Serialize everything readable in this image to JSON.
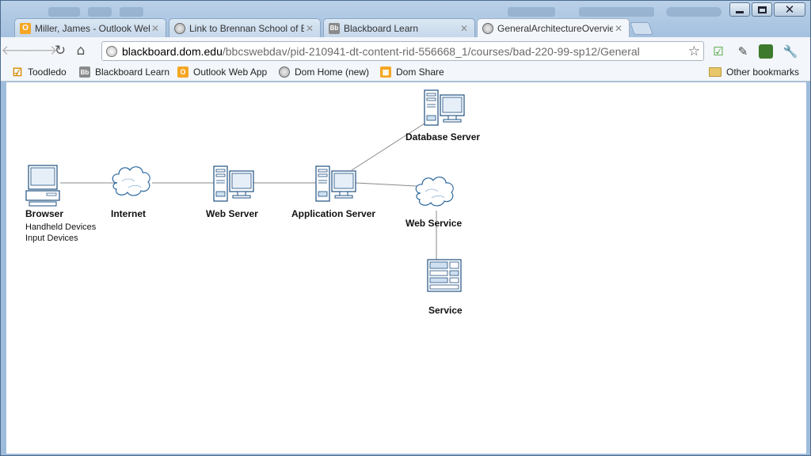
{
  "tabs": [
    {
      "title": "Miller, James - Outlook Web",
      "icon": "outlook-icon",
      "active": false
    },
    {
      "title": "Link to Brennan School of B",
      "icon": "globe-icon",
      "active": false
    },
    {
      "title": "Blackboard Learn",
      "icon": "blackboard-icon",
      "active": false
    },
    {
      "title": "GeneralArchitectureOvervie",
      "icon": "globe-icon",
      "active": true
    }
  ],
  "omnibox": {
    "host": "blackboard.dom.edu",
    "path": "/bbcswebdav/pid-210941-dt-content-rid-556668_1/courses/bad-220-99-sp12/General"
  },
  "icons": {
    "bb": "Bb",
    "outlook": "O"
  },
  "bookmarks": [
    {
      "label": "Toodledo",
      "icon": "checkmark-icon"
    },
    {
      "label": "Blackboard Learn",
      "icon": "blackboard-icon"
    },
    {
      "label": "Outlook Web App",
      "icon": "outlook-icon"
    },
    {
      "label": "Dom Home (new)",
      "icon": "globe-icon"
    },
    {
      "label": "Dom Share",
      "icon": "share-icon"
    }
  ],
  "other_bookmarks": "Other bookmarks",
  "diagram": {
    "nodes": {
      "browser": "Browser",
      "internet": "Internet",
      "web_server": "Web Server",
      "application_server": "Application Server",
      "database_server": "Database Server",
      "web_service": "Web Service",
      "service": "Service"
    },
    "browser_sublabels": [
      "Handheld Devices",
      "Input Devices"
    ]
  }
}
